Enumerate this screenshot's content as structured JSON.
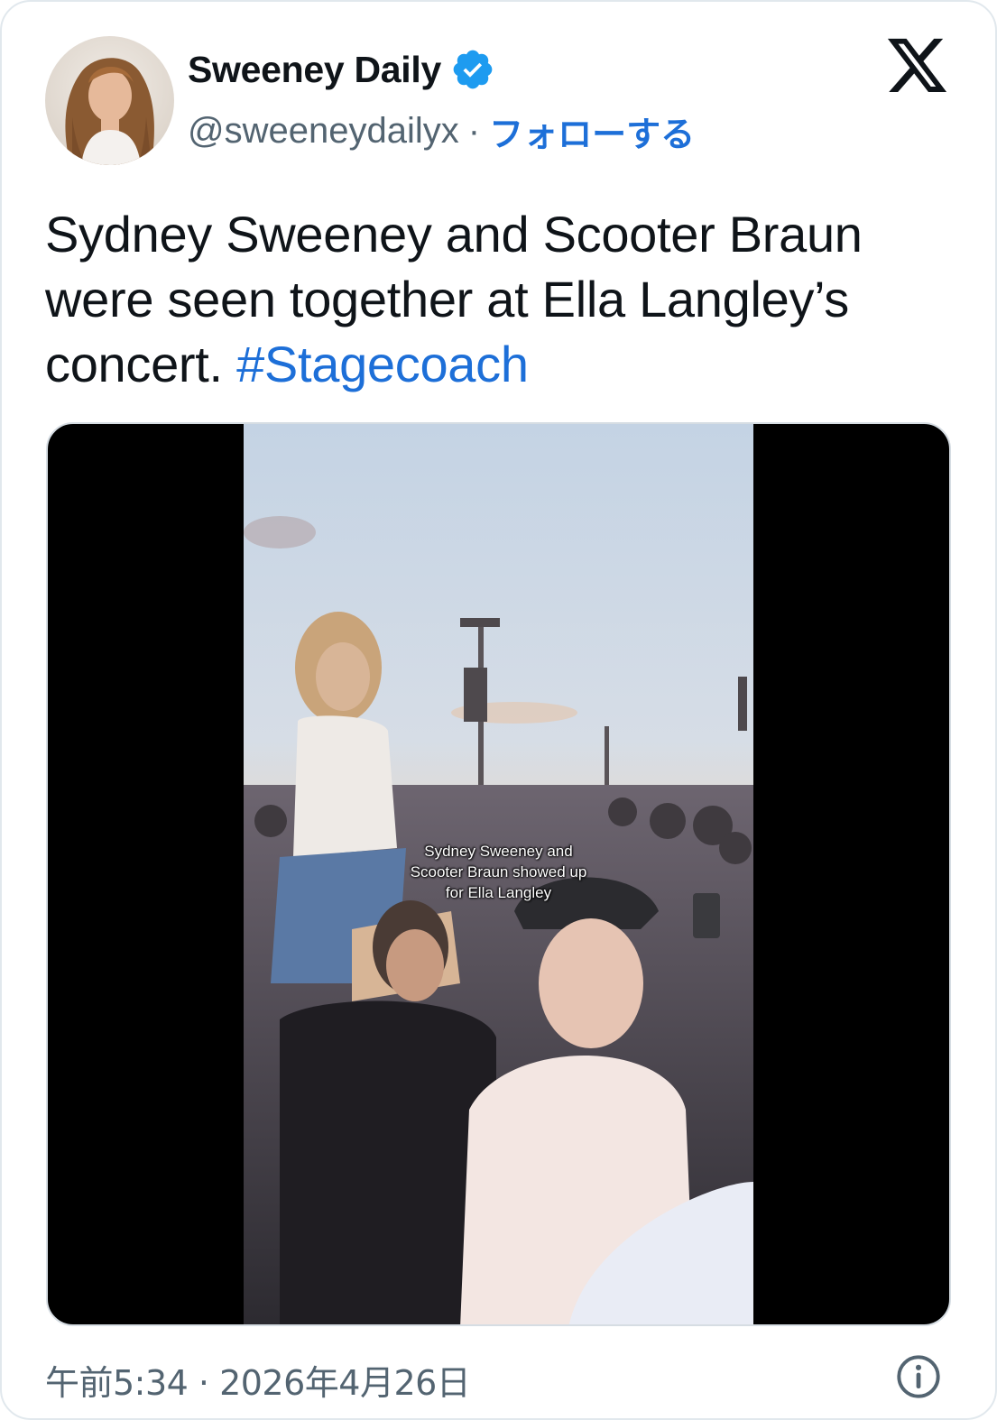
{
  "account": {
    "display_name": "Sweeney Daily",
    "handle": "@sweeneydailyx",
    "separator": "·",
    "follow_label": "フォローする",
    "verified": true
  },
  "tweet": {
    "text": "Sydney Sweeney and Scooter Braun were seen together at Ella Langley’s concert.",
    "hashtag": "#Stagecoach"
  },
  "media": {
    "type": "video",
    "caption_lines": [
      "Sydney Sweeney and",
      "Scooter Braun showed up",
      "for Ella Langley"
    ]
  },
  "footer": {
    "timestamp": "午前5:34 · 2026年4月26日"
  },
  "icons": {
    "brand": "x-logo-icon",
    "verified": "verified-badge-icon",
    "info": "info-icon"
  },
  "colors": {
    "link": "#1d6fd8",
    "verified_badge": "#1d9bf0",
    "secondary_text": "#536471",
    "primary_text": "#0f1419"
  }
}
